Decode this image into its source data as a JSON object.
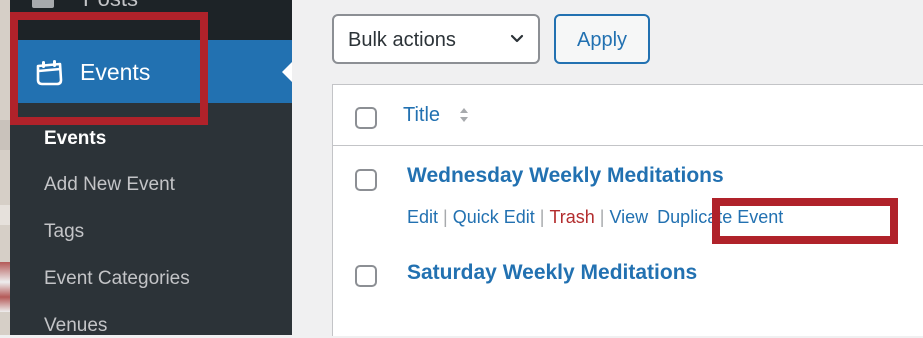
{
  "sidebar": {
    "top_item": {
      "label": "Posts"
    },
    "current_menu": {
      "label": "Events",
      "icon": "calendar-icon"
    },
    "submenu": [
      {
        "label": "Events",
        "active": true
      },
      {
        "label": "Add New Event",
        "active": false
      },
      {
        "label": "Tags",
        "active": false
      },
      {
        "label": "Event Categories",
        "active": false
      },
      {
        "label": "Venues",
        "active": false
      }
    ]
  },
  "toolbar": {
    "bulk_actions": {
      "selected": "Bulk actions",
      "icon": "chevron-down-icon"
    },
    "apply_label": "Apply"
  },
  "table": {
    "columns": [
      {
        "label": "Title",
        "sortable": true
      }
    ],
    "rows": [
      {
        "title": "Wednesday Weekly Meditations",
        "actions": {
          "edit": "Edit",
          "quick_edit": "Quick Edit",
          "trash": "Trash",
          "view": "View",
          "duplicate": "Duplicate Event"
        },
        "separator": "|"
      },
      {
        "title": "Saturday Weekly Meditations"
      }
    ]
  },
  "colors": {
    "admin_blue": "#2271b1",
    "sidebar_bg": "#1d2327",
    "submenu_bg": "#2c3338",
    "highlight_red": "#b0222a",
    "trash_red": "#b32d2e"
  }
}
